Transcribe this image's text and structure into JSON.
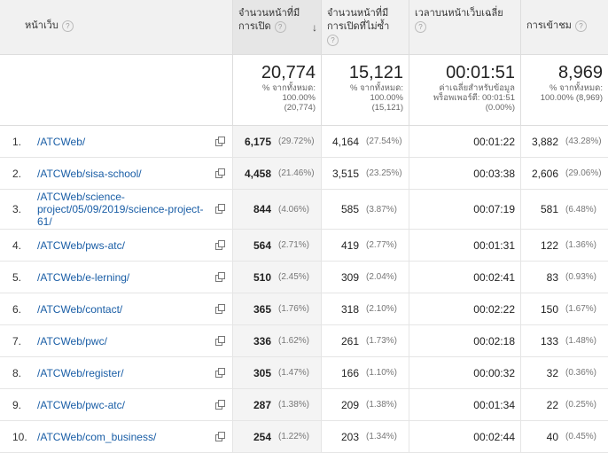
{
  "header": {
    "page_col": "หน้าเว็บ",
    "pageviews_col": "จำนวนหน้าที่มีการเปิด",
    "unique_col": "จำนวนหน้าที่มีการเปิดที่ไม่ซ้ำ",
    "time_col": "เวลาบนหน้าเว็บเฉลี่ย",
    "entrances_col": "การเข้าชม",
    "help_symbol": "?",
    "sort_symbol": "↓"
  },
  "totals": {
    "pageviews": "20,774",
    "pageviews_sub1": "% จากทั้งหมด:",
    "pageviews_sub2": "100.00%",
    "pageviews_sub3": "(20,774)",
    "unique": "15,121",
    "unique_sub1": "% จากทั้งหมด:",
    "unique_sub2": "100.00%",
    "unique_sub3": "(15,121)",
    "time": "00:01:51",
    "time_sub1": "ค่าเฉลี่ยสำหรับข้อมูล",
    "time_sub2": "พร็อพเพอร์ตี: 00:01:51",
    "time_sub3": "(0.00%)",
    "entrances": "8,969",
    "entrances_sub1": "% จากทั้งหมด:",
    "entrances_sub2": "100.00% (8,969)"
  },
  "rows": [
    {
      "idx": "1.",
      "page": "/ATCWeb/",
      "pv": "6,175",
      "pvp": "(29.72%)",
      "uv": "4,164",
      "uvp": "(27.54%)",
      "time": "00:01:22",
      "en": "3,882",
      "enp": "(43.28%)"
    },
    {
      "idx": "2.",
      "page": "/ATCWeb/sisa-school/",
      "pv": "4,458",
      "pvp": "(21.46%)",
      "uv": "3,515",
      "uvp": "(23.25%)",
      "time": "00:03:38",
      "en": "2,606",
      "enp": "(29.06%)"
    },
    {
      "idx": "3.",
      "page": "/ATCWeb/science-project/05/09/2019/science-project-61/",
      "pv": "844",
      "pvp": "(4.06%)",
      "uv": "585",
      "uvp": "(3.87%)",
      "time": "00:07:19",
      "en": "581",
      "enp": "(6.48%)"
    },
    {
      "idx": "4.",
      "page": "/ATCWeb/pws-atc/",
      "pv": "564",
      "pvp": "(2.71%)",
      "uv": "419",
      "uvp": "(2.77%)",
      "time": "00:01:31",
      "en": "122",
      "enp": "(1.36%)"
    },
    {
      "idx": "5.",
      "page": "/ATCWeb/e-lerning/",
      "pv": "510",
      "pvp": "(2.45%)",
      "uv": "309",
      "uvp": "(2.04%)",
      "time": "00:02:41",
      "en": "83",
      "enp": "(0.93%)"
    },
    {
      "idx": "6.",
      "page": "/ATCWeb/contact/",
      "pv": "365",
      "pvp": "(1.76%)",
      "uv": "318",
      "uvp": "(2.10%)",
      "time": "00:02:22",
      "en": "150",
      "enp": "(1.67%)"
    },
    {
      "idx": "7.",
      "page": "/ATCWeb/pwc/",
      "pv": "336",
      "pvp": "(1.62%)",
      "uv": "261",
      "uvp": "(1.73%)",
      "time": "00:02:18",
      "en": "133",
      "enp": "(1.48%)"
    },
    {
      "idx": "8.",
      "page": "/ATCWeb/register/",
      "pv": "305",
      "pvp": "(1.47%)",
      "uv": "166",
      "uvp": "(1.10%)",
      "time": "00:00:32",
      "en": "32",
      "enp": "(0.36%)"
    },
    {
      "idx": "9.",
      "page": "/ATCWeb/pwc-atc/",
      "pv": "287",
      "pvp": "(1.38%)",
      "uv": "209",
      "uvp": "(1.38%)",
      "time": "00:01:34",
      "en": "22",
      "enp": "(0.25%)"
    },
    {
      "idx": "10.",
      "page": "/ATCWeb/com_business/",
      "pv": "254",
      "pvp": "(1.22%)",
      "uv": "203",
      "uvp": "(1.34%)",
      "time": "00:02:44",
      "en": "40",
      "enp": "(0.45%)"
    }
  ]
}
